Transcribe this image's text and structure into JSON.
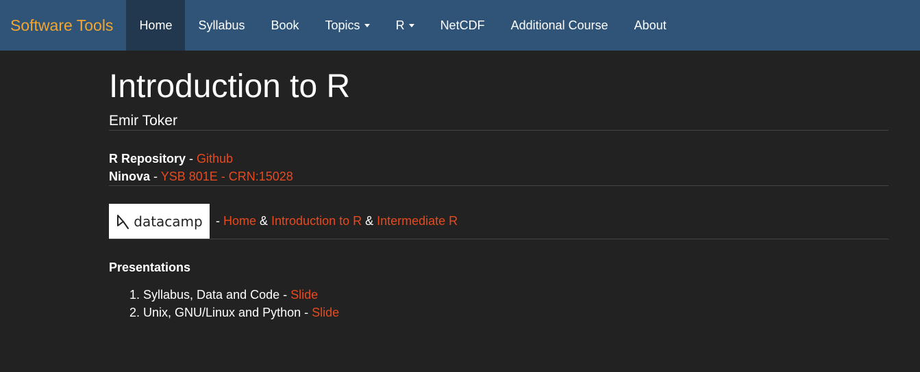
{
  "navbar": {
    "brand": "Software Tools",
    "items": [
      {
        "label": "Home",
        "active": true,
        "dropdown": false
      },
      {
        "label": "Syllabus",
        "active": false,
        "dropdown": false
      },
      {
        "label": "Book",
        "active": false,
        "dropdown": false
      },
      {
        "label": "Topics",
        "active": false,
        "dropdown": true
      },
      {
        "label": "R",
        "active": false,
        "dropdown": true
      },
      {
        "label": "NetCDF",
        "active": false,
        "dropdown": false
      },
      {
        "label": "Additional Course",
        "active": false,
        "dropdown": false
      },
      {
        "label": "About",
        "active": false,
        "dropdown": false
      }
    ]
  },
  "page": {
    "title": "Introduction to R",
    "author": "Emir Toker"
  },
  "resources": {
    "repo_label": "R Repository",
    "repo_sep": " - ",
    "repo_link": "Github",
    "ninova_label": "Ninova",
    "ninova_sep": " - ",
    "ninova_link": "YSB 801E - CRN:15028"
  },
  "datacamp": {
    "logo_text": "datacamp",
    "sep": " - ",
    "link_home": "Home",
    "amp1": " & ",
    "link_intro": "Introduction to R",
    "amp2": " & ",
    "link_intermediate": "Intermediate R"
  },
  "presentations": {
    "heading": "Presentations",
    "items": [
      {
        "text": "Syllabus, Data and Code - ",
        "link": "Slide"
      },
      {
        "text": "Unix, GNU/Linux and Python - ",
        "link": "Slide"
      }
    ]
  },
  "colors": {
    "navbar_bg": "#2f5477",
    "navbar_active": "#22384f",
    "brand": "#f2a631",
    "link": "#e8491d",
    "page_bg": "#222222"
  }
}
